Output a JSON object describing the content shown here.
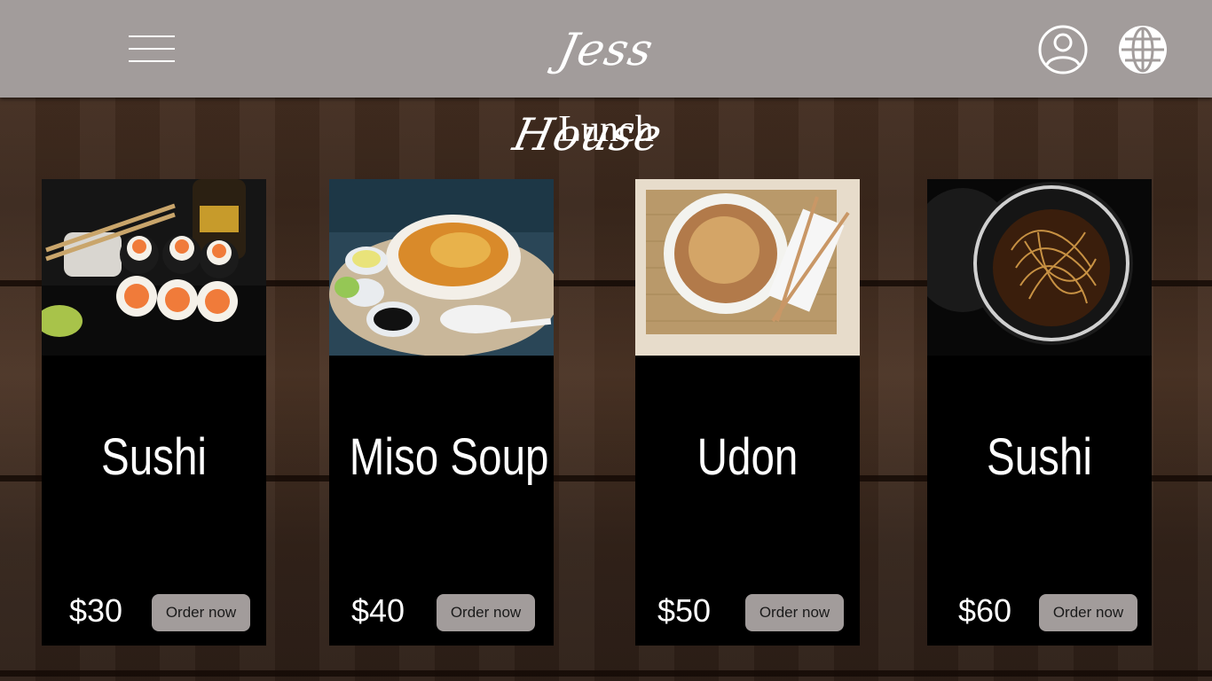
{
  "header": {
    "logo_text": "Jess House"
  },
  "section": {
    "title": "Lunch"
  },
  "colors": {
    "topbar": "#a29c9b",
    "card_bg": "#000000",
    "button_bg": "#a29c9b",
    "text": "#ffffff"
  },
  "icons": {
    "menu": "hamburger-menu-icon",
    "account": "user-account-icon",
    "language": "globe-icon"
  },
  "menu_items": [
    {
      "name": "Sushi",
      "price": "$30",
      "button": "Order now",
      "image": "sushi-rolls-photo"
    },
    {
      "name": "Miso Soup",
      "price": "$40",
      "button": "Order now",
      "image": "noodle-soup-photo"
    },
    {
      "name": "Udon",
      "price": "$50",
      "button": "Order now",
      "image": "udon-noodles-photo"
    },
    {
      "name": "Sushi",
      "price": "$60",
      "button": "Order now",
      "image": "noodle-bowl-photo"
    }
  ]
}
